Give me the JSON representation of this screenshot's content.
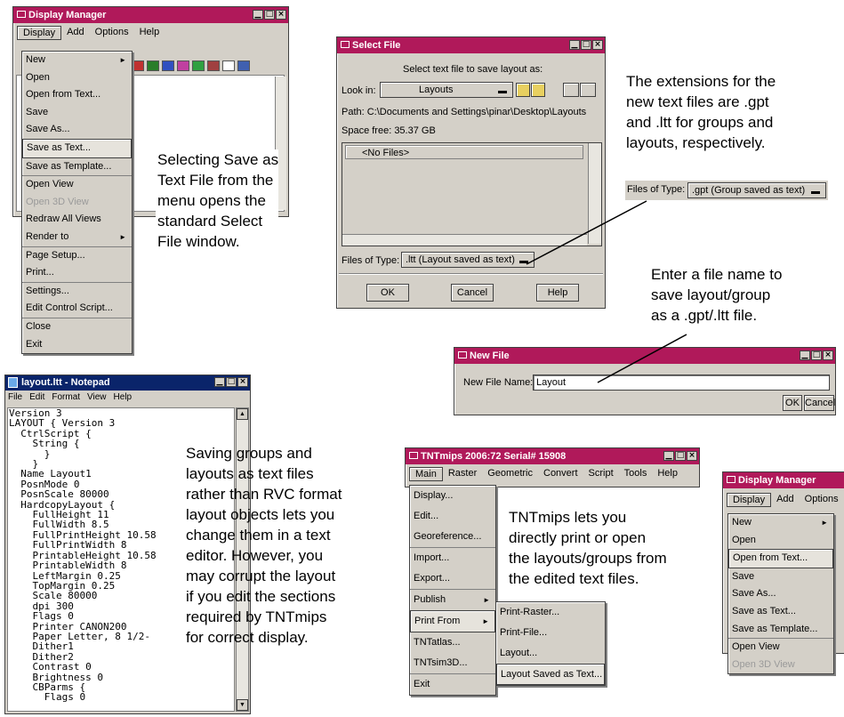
{
  "dm1": {
    "title": "Display Manager",
    "menubar": [
      "Display",
      "Add",
      "Options",
      "Help"
    ],
    "menu": [
      "New",
      "Open",
      "Open from Text...",
      "Save",
      "Save As...",
      "Save as Text...",
      "Save as Template...",
      "Open View",
      "Open 3D View",
      "Redraw All Views",
      "Render to",
      "Page Setup...",
      "Print...",
      "Settings...",
      "Edit Control Script...",
      "Close",
      "Exit"
    ]
  },
  "select_file": {
    "title": "Select File",
    "prompt": "Select text file to save layout as:",
    "look_in_label": "Look in:",
    "look_in_value": "Layouts",
    "path": "Path: C:\\Documents and Settings\\pinar\\Desktop\\Layouts",
    "space": "Space free:  35.37 GB",
    "list_item": "<No Files>",
    "files_of_type_label": "Files of Type:",
    "files_of_type_value": ".ltt (Layout saved as text)",
    "ok": "OK",
    "cancel": "Cancel",
    "help": "Help"
  },
  "extension_note": {
    "text": "The extensions for the\nnew text files are .gpt\nand .ltt for groups and\nlayouts, respectively.",
    "files_of_type_label": "Files of Type:",
    "files_of_type_value": ".gpt (Group saved as text)"
  },
  "caption_select": "Selecting Save as\nText File from the\nmenu opens the\nstandard Select\nFile window.",
  "caption_enter": "Enter a file name to\nsave layout/group\nas a .gpt/.ltt file.",
  "new_file": {
    "title": "New File",
    "label": "New File Name:",
    "value": "Layout",
    "ok": "OK",
    "cancel": "Cancel"
  },
  "notepad": {
    "title": "layout.ltt - Notepad",
    "menu": [
      "File",
      "Edit",
      "Format",
      "View",
      "Help"
    ],
    "content": "Version 3\nLAYOUT { Version 3\n  CtrlScript {\n    String {\n      }\n    }\n  Name Layout1\n  PosnMode 0\n  PosnScale 80000\n  HardcopyLayout {\n    FullHeight 11\n    FullWidth 8.5\n    FullPrintHeight 10.58\n    FullPrintWidth 8\n    PrintableHeight 10.58\n    PrintableWidth 8\n    LeftMargin 0.25\n    TopMargin 0.25\n    Scale 80000\n    dpi 300\n    Flags 0\n    Printer CANON200\n    Paper Letter, 8 1/2-\n    Dither1\n    Dither2\n    Contrast 0\n    Brightness 0\n    CBParms {\n      Flags 0"
  },
  "caption_saving": "Saving groups and\nlayouts as text files\nrather than RVC format\nlayout objects lets you\nchange them in a text\neditor. However, you\nmay corrupt the layout\nif you edit the sections\nrequired by TNTmips\nfor correct display.",
  "tntmips": {
    "title": "TNTmips 2006:72  Serial# 15908",
    "menubar": [
      "Main",
      "Raster",
      "Geometric",
      "Convert",
      "Script",
      "Tools",
      "Help"
    ],
    "menu": [
      "Display...",
      "Edit...",
      "Georeference...",
      "Import...",
      "Export...",
      "Publish",
      "Print From",
      "TNTatlas...",
      "TNTsim3D...",
      "Exit"
    ],
    "submenu": [
      "Print-Raster...",
      "Print-File...",
      "Layout...",
      "Layout Saved as Text..."
    ]
  },
  "caption_tnt": "TNTmips lets you\ndirectly print or open\nthe layouts/groups from\nthe edited text files.",
  "dm2": {
    "title": "Display Manager",
    "menubar": [
      "Display",
      "Add",
      "Options"
    ],
    "menu": [
      "New",
      "Open",
      "Open from Text...",
      "Save",
      "Save As...",
      "Save as Text...",
      "Save as Template...",
      "Open View",
      "Open 3D View"
    ]
  },
  "colors": {
    "title_bar": "#b0195a",
    "notepad_title": "#0a246a",
    "chrome": "#d4d0c8"
  }
}
